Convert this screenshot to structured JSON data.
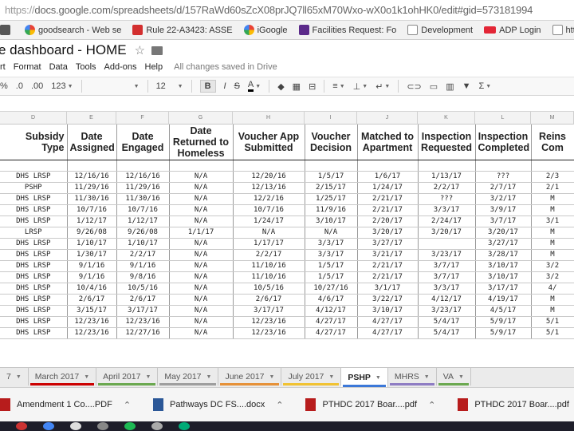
{
  "browser": {
    "url_scheme": "https://",
    "url": "docs.google.com/spreadsheets/d/157RaWd60sZcX08prJQ7ll65xM70Wxo-wX0o1k1ohHK0/edit#gid=573181994",
    "bookmarks": [
      {
        "label": "",
        "icon": "apps-icon"
      },
      {
        "label": "goodsearch - Web se",
        "icon": "goodsearch-icon"
      },
      {
        "label": "Rule 22-A3423: ASSE",
        "icon": "pdf-icon"
      },
      {
        "label": "iGoogle",
        "icon": "google-icon"
      },
      {
        "label": "Facilities Request: Fo",
        "icon": "form-icon"
      },
      {
        "label": "Development",
        "icon": "file-icon"
      },
      {
        "label": "ADP Login",
        "icon": "adp-icon"
      },
      {
        "label": "https://top.capitalone",
        "icon": "file-icon"
      }
    ]
  },
  "doc": {
    "title": "e dashboard - HOME",
    "star_icon": "star-icon",
    "folder_icon": "folder-icon"
  },
  "menu": {
    "items": [
      "rt",
      "Format",
      "Data",
      "Tools",
      "Add-ons",
      "Help"
    ],
    "saved_status": "All changes saved in Drive"
  },
  "toolbar": {
    "percent": "%",
    "dec_less": ".0",
    "dec_more": ".00",
    "number_format": "123",
    "font_size": "12",
    "bold": "B",
    "strike": "S",
    "text_color": "A"
  },
  "columns": [
    "D",
    "E",
    "F",
    "G",
    "H",
    "I",
    "J",
    "K",
    "L",
    "M"
  ],
  "headers": [
    "Subsidy Type",
    "Date Assigned",
    "Date Engaged",
    "Date Returned to Homeless",
    "Voucher App Submitted",
    "Voucher Decision",
    "Matched to Apartment",
    "Inspection Requested",
    "Inspection Completed",
    "Reins Com"
  ],
  "rows": [
    [
      "DHS LRSP",
      "12/16/16",
      "12/16/16",
      "N/A",
      "12/20/16",
      "1/5/17",
      "1/6/17",
      "1/13/17",
      "???",
      "2/3"
    ],
    [
      "PSHP",
      "11/29/16",
      "11/29/16",
      "N/A",
      "12/13/16",
      "2/15/17",
      "1/24/17",
      "2/2/17",
      "2/7/17",
      "2/1"
    ],
    [
      "DHS LRSP",
      "11/30/16",
      "11/30/16",
      "N/A",
      "12/2/16",
      "1/25/17",
      "2/21/17",
      "???",
      "3/2/17",
      "M"
    ],
    [
      "DHS LRSP",
      "10/7/16",
      "10/7/16",
      "N/A",
      "10/7/16",
      "11/9/16",
      "2/21/17",
      "3/3/17",
      "3/9/17",
      "M"
    ],
    [
      "DHS LRSP",
      "1/12/17",
      "1/12/17",
      "N/A",
      "1/24/17",
      "3/10/17",
      "2/20/17",
      "2/24/17",
      "3/7/17",
      "3/1"
    ],
    [
      "LRSP",
      "9/26/08",
      "9/26/08",
      "1/1/17",
      "N/A",
      "N/A",
      "3/20/17",
      "3/20/17",
      "3/20/17",
      "M"
    ],
    [
      "DHS LRSP",
      "1/10/17",
      "1/10/17",
      "N/A",
      "1/17/17",
      "3/3/17",
      "3/27/17",
      "",
      "3/27/17",
      "M"
    ],
    [
      "DHS LRSP",
      "1/30/17",
      "2/2/17",
      "N/A",
      "2/2/17",
      "3/3/17",
      "3/21/17",
      "3/23/17",
      "3/28/17",
      "M"
    ],
    [
      "DHS LRSP",
      "9/1/16",
      "9/1/16",
      "N/A",
      "11/10/16",
      "1/5/17",
      "2/21/17",
      "3/7/17",
      "3/10/17",
      "3/2"
    ],
    [
      "DHS LRSP",
      "9/1/16",
      "9/8/16",
      "N/A",
      "11/10/16",
      "1/5/17",
      "2/21/17",
      "3/7/17",
      "3/10/17",
      "3/2"
    ],
    [
      "DHS LRSP",
      "10/4/16",
      "10/5/16",
      "N/A",
      "10/5/16",
      "10/27/16",
      "3/1/17",
      "3/3/17",
      "3/17/17",
      "4/"
    ],
    [
      "DHS LRSP",
      "2/6/17",
      "2/6/17",
      "N/A",
      "2/6/17",
      "4/6/17",
      "3/22/17",
      "4/12/17",
      "4/19/17",
      "M"
    ],
    [
      "DHS LRSP",
      "3/15/17",
      "3/17/17",
      "N/A",
      "3/17/17",
      "4/12/17",
      "3/10/17",
      "3/23/17",
      "4/5/17",
      "M"
    ],
    [
      "DHS LRSP",
      "12/23/16",
      "12/23/16",
      "N/A",
      "12/23/16",
      "4/27/17",
      "4/27/17",
      "5/4/17",
      "5/9/17",
      "5/1"
    ],
    [
      "DHS LRSP",
      "12/23/16",
      "12/27/16",
      "N/A",
      "12/23/16",
      "4/27/17",
      "4/27/17",
      "5/4/17",
      "5/9/17",
      "5/1"
    ]
  ],
  "sheet_tabs": [
    {
      "label": "7",
      "color": ""
    },
    {
      "label": "March 2017",
      "color": "#cc0000"
    },
    {
      "label": "April 2017",
      "color": "#6aa84f"
    },
    {
      "label": "May 2017",
      "color": "#9e9e9e"
    },
    {
      "label": "June 2017",
      "color": "#e69138"
    },
    {
      "label": "July 2017",
      "color": "#f1c232"
    },
    {
      "label": "PSHP",
      "color": "#3c78d8",
      "active": true
    },
    {
      "label": "MHRS",
      "color": "#8e7cc3"
    },
    {
      "label": "VA",
      "color": "#6aa84f"
    }
  ],
  "downloads": [
    {
      "label": "Amendment 1 Co....PDF",
      "type": "pdf"
    },
    {
      "label": "Pathways DC FS....docx",
      "type": "doc"
    },
    {
      "label": "PTHDC 2017 Boar....pdf",
      "type": "pdf"
    },
    {
      "label": "PTHDC 2017 Boar....pdf",
      "type": "pdf"
    }
  ]
}
